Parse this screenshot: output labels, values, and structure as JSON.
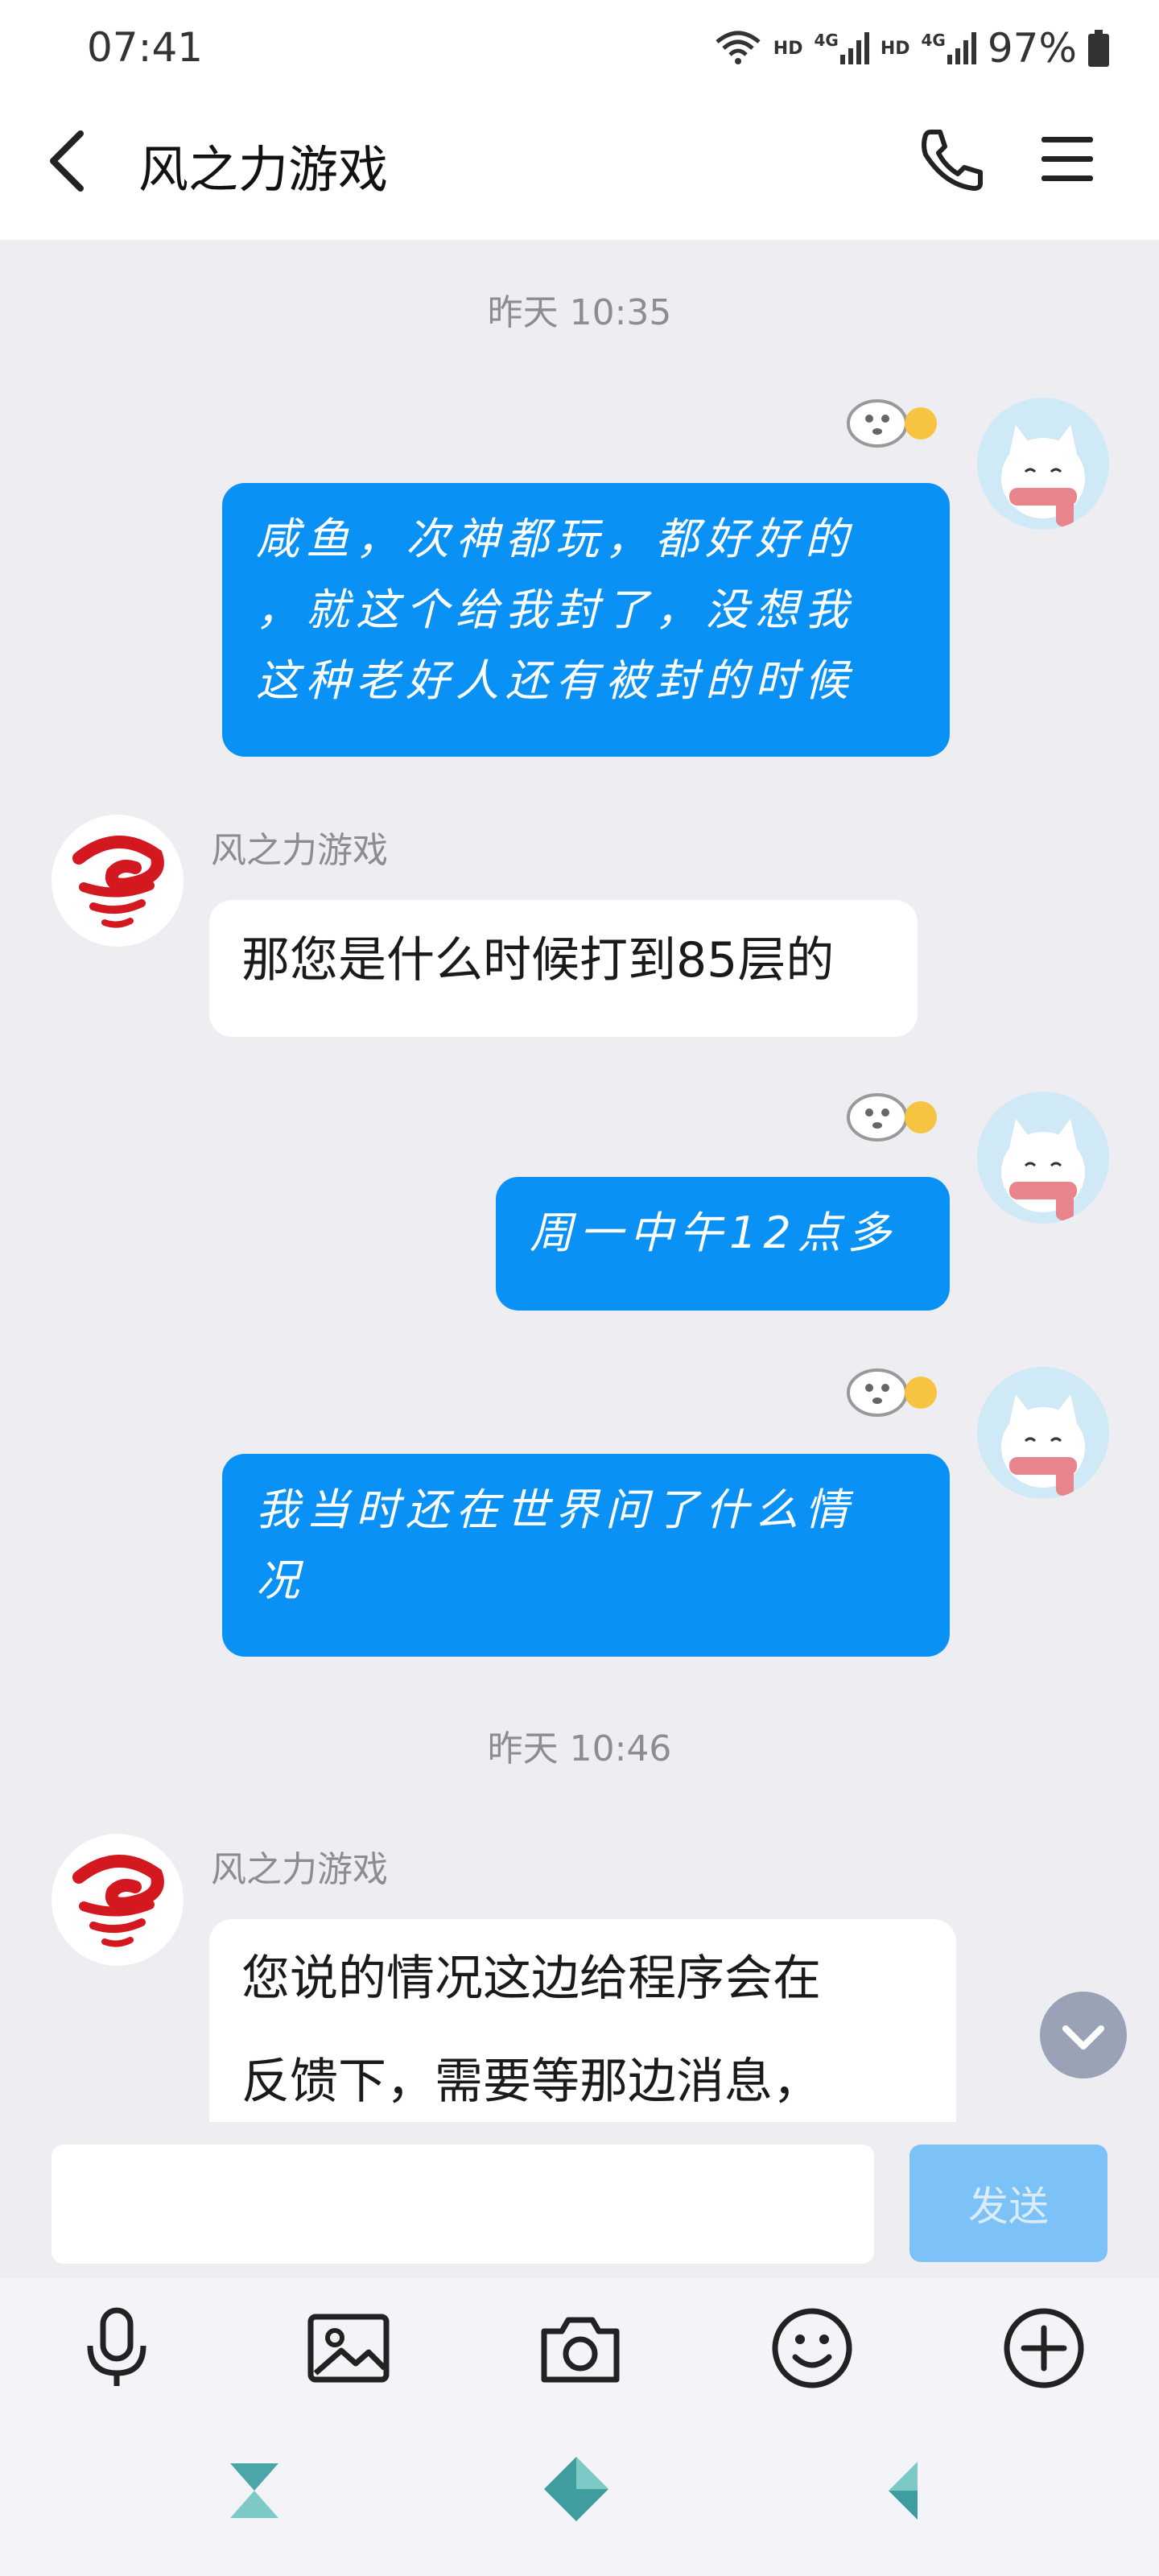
{
  "status_bar": {
    "time": "07:41",
    "hd1": "HD",
    "net1": "4G",
    "hd2": "HD",
    "net2": "4G",
    "battery": "97%"
  },
  "header": {
    "title": "风之力游戏",
    "icons": [
      "back-icon",
      "phone-icon",
      "menu-icon"
    ]
  },
  "messages": [
    {
      "type": "timestamp",
      "text": "昨天 10:35"
    },
    {
      "type": "me",
      "lines": [
        "咸鱼，次神都玩，都好好的",
        "，就这个给我封了，没想我",
        "这种老好人还有被封的时候"
      ]
    },
    {
      "type": "bot",
      "sender": "风之力游戏",
      "lines": [
        "那您是什么时候打到85层的"
      ]
    },
    {
      "type": "me",
      "lines": [
        "周一中午12点多"
      ]
    },
    {
      "type": "me",
      "lines": [
        "我当时还在世界问了什么情",
        "况"
      ]
    },
    {
      "type": "timestamp",
      "text": "昨天 10:46"
    },
    {
      "type": "bot",
      "sender": "风之力游戏",
      "lines": [
        "您说的情况这边给程序会在",
        "反馈下，需要等那边消息，"
      ]
    }
  ],
  "input": {
    "value": "",
    "send_label": "发送"
  },
  "toolbar": {
    "icons": [
      "microphone-icon",
      "image-icon",
      "camera-icon",
      "emoji-icon",
      "plus-icon"
    ]
  },
  "colors": {
    "my_bubble": "#0a91f5",
    "bot_bubble": "#ffffff",
    "background": "#ededf2",
    "send_button": "#7cc2f7"
  }
}
